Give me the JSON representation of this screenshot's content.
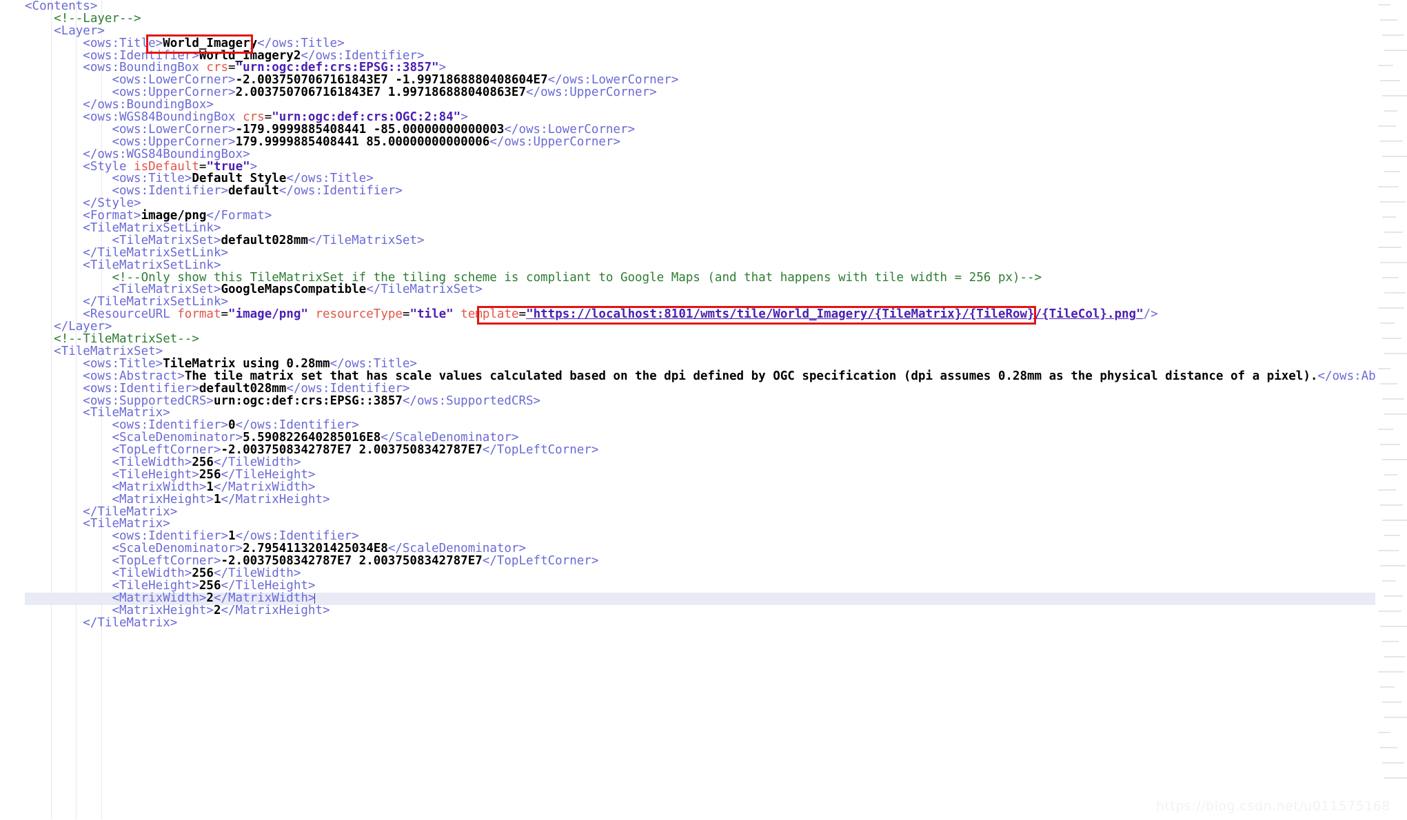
{
  "editor": {
    "language": "xml",
    "watermark": "https://blog.csdn.net/u011575168",
    "caret_line_index": 49,
    "colors": {
      "background": "#ffffff",
      "tag": "#6a6ad6",
      "text": "#000000",
      "attribute_name": "#e0564a",
      "attribute_value": "#4b1fb4",
      "comment": "#2e7d32",
      "annotation_box": "#e41313",
      "current_line_highlight": "#e8eaf6",
      "watermark": "#f2f2f2"
    }
  },
  "annotations": [
    {
      "name": "layer-title-value",
      "label": "World_Imagery"
    },
    {
      "name": "resource-url-template",
      "label": "\"https://localhost:8101/wmts/tile/World_Imagery/{TileMatrix}/{TileRow}/{TileCol}.png\""
    }
  ],
  "code_lines": [
    {
      "indent": 0,
      "tokens": [
        {
          "c": "tag",
          "t": "<Contents>"
        }
      ]
    },
    {
      "indent": 1,
      "tokens": [
        {
          "c": "cmt",
          "t": "<!--Layer-->"
        }
      ]
    },
    {
      "indent": 1,
      "tokens": [
        {
          "c": "tag",
          "t": "<Layer>"
        }
      ]
    },
    {
      "indent": 2,
      "tokens": [
        {
          "c": "tag",
          "t": "<ows:Title>"
        },
        {
          "c": "txt",
          "t": "World_Imagery"
        },
        {
          "c": "tag",
          "t": "</ows:Title>"
        }
      ]
    },
    {
      "indent": 2,
      "tokens": [
        {
          "c": "tag",
          "t": "<ows:Identifier>"
        },
        {
          "c": "txt",
          "t": "World_Imagery2"
        },
        {
          "c": "tag",
          "t": "</ows:Identifier>"
        }
      ]
    },
    {
      "indent": 2,
      "tokens": [
        {
          "c": "tag",
          "t": "<ows:BoundingBox "
        },
        {
          "c": "attr",
          "t": "crs"
        },
        {
          "c": "eq",
          "t": "="
        },
        {
          "c": "val",
          "t": "\"urn:ogc:def:crs:EPSG::3857\""
        },
        {
          "c": "tag",
          "t": ">"
        }
      ]
    },
    {
      "indent": 3,
      "tokens": [
        {
          "c": "tag",
          "t": "<ows:LowerCorner>"
        },
        {
          "c": "txt",
          "t": "-2.0037507067161843E7 -1.9971868880408604E7"
        },
        {
          "c": "tag",
          "t": "</ows:LowerCorner>"
        }
      ]
    },
    {
      "indent": 3,
      "tokens": [
        {
          "c": "tag",
          "t": "<ows:UpperCorner>"
        },
        {
          "c": "txt",
          "t": "2.0037507067161843E7 1.997186888040863E7"
        },
        {
          "c": "tag",
          "t": "</ows:UpperCorner>"
        }
      ]
    },
    {
      "indent": 2,
      "tokens": [
        {
          "c": "tag",
          "t": "</ows:BoundingBox>"
        }
      ]
    },
    {
      "indent": 2,
      "tokens": [
        {
          "c": "tag",
          "t": "<ows:WGS84BoundingBox "
        },
        {
          "c": "attr",
          "t": "crs"
        },
        {
          "c": "eq",
          "t": "="
        },
        {
          "c": "val",
          "t": "\"urn:ogc:def:crs:OGC:2:84\""
        },
        {
          "c": "tag",
          "t": ">"
        }
      ]
    },
    {
      "indent": 3,
      "tokens": [
        {
          "c": "tag",
          "t": "<ows:LowerCorner>"
        },
        {
          "c": "txt",
          "t": "-179.9999885408441 -85.00000000000003"
        },
        {
          "c": "tag",
          "t": "</ows:LowerCorner>"
        }
      ]
    },
    {
      "indent": 3,
      "tokens": [
        {
          "c": "tag",
          "t": "<ows:UpperCorner>"
        },
        {
          "c": "txt",
          "t": "179.9999885408441 85.00000000000006"
        },
        {
          "c": "tag",
          "t": "</ows:UpperCorner>"
        }
      ]
    },
    {
      "indent": 2,
      "tokens": [
        {
          "c": "tag",
          "t": "</ows:WGS84BoundingBox>"
        }
      ]
    },
    {
      "indent": 2,
      "tokens": [
        {
          "c": "tag",
          "t": "<Style "
        },
        {
          "c": "attr",
          "t": "isDefault"
        },
        {
          "c": "eq",
          "t": "="
        },
        {
          "c": "val",
          "t": "\"true\""
        },
        {
          "c": "tag",
          "t": ">"
        }
      ]
    },
    {
      "indent": 3,
      "tokens": [
        {
          "c": "tag",
          "t": "<ows:Title>"
        },
        {
          "c": "txt",
          "t": "Default Style"
        },
        {
          "c": "tag",
          "t": "</ows:Title>"
        }
      ]
    },
    {
      "indent": 3,
      "tokens": [
        {
          "c": "tag",
          "t": "<ows:Identifier>"
        },
        {
          "c": "txt",
          "t": "default"
        },
        {
          "c": "tag",
          "t": "</ows:Identifier>"
        }
      ]
    },
    {
      "indent": 2,
      "tokens": [
        {
          "c": "tag",
          "t": "</Style>"
        }
      ]
    },
    {
      "indent": 2,
      "tokens": [
        {
          "c": "tag",
          "t": "<Format>"
        },
        {
          "c": "txt",
          "t": "image/png"
        },
        {
          "c": "tag",
          "t": "</Format>"
        }
      ]
    },
    {
      "indent": 2,
      "tokens": [
        {
          "c": "tag",
          "t": "<TileMatrixSetLink>"
        }
      ]
    },
    {
      "indent": 3,
      "tokens": [
        {
          "c": "tag",
          "t": "<TileMatrixSet>"
        },
        {
          "c": "txt",
          "t": "default028mm"
        },
        {
          "c": "tag",
          "t": "</TileMatrixSet>"
        }
      ]
    },
    {
      "indent": 2,
      "tokens": [
        {
          "c": "tag",
          "t": "</TileMatrixSetLink>"
        }
      ]
    },
    {
      "indent": 2,
      "tokens": [
        {
          "c": "tag",
          "t": "<TileMatrixSetLink>"
        }
      ]
    },
    {
      "indent": 3,
      "tokens": [
        {
          "c": "cmt",
          "t": "<!--Only show this TileMatrixSet if the tiling scheme is compliant to Google Maps (and that happens with tile width = 256 px)-->"
        }
      ]
    },
    {
      "indent": 3,
      "tokens": [
        {
          "c": "tag",
          "t": "<TileMatrixSet>"
        },
        {
          "c": "txt",
          "t": "GoogleMapsCompatible"
        },
        {
          "c": "tag",
          "t": "</TileMatrixSet>"
        }
      ]
    },
    {
      "indent": 2,
      "tokens": [
        {
          "c": "tag",
          "t": "</TileMatrixSetLink>"
        }
      ]
    },
    {
      "indent": 2,
      "tokens": [
        {
          "c": "tag",
          "t": "<ResourceURL "
        },
        {
          "c": "attr",
          "t": "format"
        },
        {
          "c": "eq",
          "t": "="
        },
        {
          "c": "val",
          "t": "\"image/png\""
        },
        {
          "c": "tag",
          "t": " "
        },
        {
          "c": "attr",
          "t": "resourceType"
        },
        {
          "c": "eq",
          "t": "="
        },
        {
          "c": "val",
          "t": "\"tile\""
        },
        {
          "c": "tag",
          "t": " "
        },
        {
          "c": "attr",
          "t": "template"
        },
        {
          "c": "eq",
          "t": "="
        },
        {
          "c": "link",
          "t": "\"https://localhost:8101/wmts/tile/World_Imagery/{TileMatrix}/{TileRow}/{TileCol}.png\""
        },
        {
          "c": "tag",
          "t": "/>"
        }
      ]
    },
    {
      "indent": 1,
      "tokens": [
        {
          "c": "tag",
          "t": "</Layer>"
        }
      ]
    },
    {
      "indent": 1,
      "tokens": [
        {
          "c": "cmt",
          "t": "<!--TileMatrixSet-->"
        }
      ]
    },
    {
      "indent": 1,
      "tokens": [
        {
          "c": "tag",
          "t": "<TileMatrixSet>"
        }
      ]
    },
    {
      "indent": 2,
      "tokens": [
        {
          "c": "tag",
          "t": "<ows:Title>"
        },
        {
          "c": "txt",
          "t": "TileMatrix using 0.28mm"
        },
        {
          "c": "tag",
          "t": "</ows:Title>"
        }
      ]
    },
    {
      "indent": 2,
      "tokens": [
        {
          "c": "tag",
          "t": "<ows:Abstract>"
        },
        {
          "c": "txt",
          "t": "The tile matrix set that has scale values calculated based on the dpi defined by OGC specification (dpi assumes 0.28mm as the physical distance of a pixel)."
        },
        {
          "c": "tag",
          "t": "</ows:Abstract>"
        }
      ]
    },
    {
      "indent": 2,
      "tokens": [
        {
          "c": "tag",
          "t": "<ows:Identifier>"
        },
        {
          "c": "txt",
          "t": "default028mm"
        },
        {
          "c": "tag",
          "t": "</ows:Identifier>"
        }
      ]
    },
    {
      "indent": 2,
      "tokens": [
        {
          "c": "tag",
          "t": "<ows:SupportedCRS>"
        },
        {
          "c": "txt",
          "t": "urn:ogc:def:crs:EPSG::3857"
        },
        {
          "c": "tag",
          "t": "</ows:SupportedCRS>"
        }
      ]
    },
    {
      "indent": 2,
      "tokens": [
        {
          "c": "tag",
          "t": "<TileMatrix>"
        }
      ]
    },
    {
      "indent": 3,
      "tokens": [
        {
          "c": "tag",
          "t": "<ows:Identifier>"
        },
        {
          "c": "txt",
          "t": "0"
        },
        {
          "c": "tag",
          "t": "</ows:Identifier>"
        }
      ]
    },
    {
      "indent": 3,
      "tokens": [
        {
          "c": "tag",
          "t": "<ScaleDenominator>"
        },
        {
          "c": "txt",
          "t": "5.590822640285016E8"
        },
        {
          "c": "tag",
          "t": "</ScaleDenominator>"
        }
      ]
    },
    {
      "indent": 3,
      "tokens": [
        {
          "c": "tag",
          "t": "<TopLeftCorner>"
        },
        {
          "c": "txt",
          "t": "-2.0037508342787E7 2.0037508342787E7"
        },
        {
          "c": "tag",
          "t": "</TopLeftCorner>"
        }
      ]
    },
    {
      "indent": 3,
      "tokens": [
        {
          "c": "tag",
          "t": "<TileWidth>"
        },
        {
          "c": "txt",
          "t": "256"
        },
        {
          "c": "tag",
          "t": "</TileWidth>"
        }
      ]
    },
    {
      "indent": 3,
      "tokens": [
        {
          "c": "tag",
          "t": "<TileHeight>"
        },
        {
          "c": "txt",
          "t": "256"
        },
        {
          "c": "tag",
          "t": "</TileHeight>"
        }
      ]
    },
    {
      "indent": 3,
      "tokens": [
        {
          "c": "tag",
          "t": "<MatrixWidth>"
        },
        {
          "c": "txt",
          "t": "1"
        },
        {
          "c": "tag",
          "t": "</MatrixWidth>"
        }
      ]
    },
    {
      "indent": 3,
      "tokens": [
        {
          "c": "tag",
          "t": "<MatrixHeight>"
        },
        {
          "c": "txt",
          "t": "1"
        },
        {
          "c": "tag",
          "t": "</MatrixHeight>"
        }
      ]
    },
    {
      "indent": 2,
      "tokens": [
        {
          "c": "tag",
          "t": "</TileMatrix>"
        }
      ]
    },
    {
      "indent": 2,
      "tokens": [
        {
          "c": "tag",
          "t": "<TileMatrix>"
        }
      ]
    },
    {
      "indent": 3,
      "tokens": [
        {
          "c": "tag",
          "t": "<ows:Identifier>"
        },
        {
          "c": "txt",
          "t": "1"
        },
        {
          "c": "tag",
          "t": "</ows:Identifier>"
        }
      ]
    },
    {
      "indent": 3,
      "tokens": [
        {
          "c": "tag",
          "t": "<ScaleDenominator>"
        },
        {
          "c": "txt",
          "t": "2.7954113201425034E8"
        },
        {
          "c": "tag",
          "t": "</ScaleDenominator>"
        }
      ]
    },
    {
      "indent": 3,
      "tokens": [
        {
          "c": "tag",
          "t": "<TopLeftCorner>"
        },
        {
          "c": "txt",
          "t": "-2.0037508342787E7 2.0037508342787E7"
        },
        {
          "c": "tag",
          "t": "</TopLeftCorner>"
        }
      ]
    },
    {
      "indent": 3,
      "tokens": [
        {
          "c": "tag",
          "t": "<TileWidth>"
        },
        {
          "c": "txt",
          "t": "256"
        },
        {
          "c": "tag",
          "t": "</TileWidth>"
        }
      ]
    },
    {
      "indent": 3,
      "tokens": [
        {
          "c": "tag",
          "t": "<TileHeight>"
        },
        {
          "c": "txt",
          "t": "256"
        },
        {
          "c": "tag",
          "t": "</TileHeight>"
        }
      ]
    },
    {
      "indent": 3,
      "tokens": [
        {
          "c": "tag",
          "t": "<MatrixWidth>"
        },
        {
          "c": "txt",
          "t": "2"
        },
        {
          "c": "tag",
          "t": "</MatrixWidth>"
        }
      ],
      "current": true,
      "caret": true
    },
    {
      "indent": 3,
      "tokens": [
        {
          "c": "tag",
          "t": "<MatrixHeight>"
        },
        {
          "c": "txt",
          "t": "2"
        },
        {
          "c": "tag",
          "t": "</MatrixHeight>"
        }
      ]
    },
    {
      "indent": 2,
      "tokens": [
        {
          "c": "tag",
          "t": "</TileMatrix>"
        }
      ]
    }
  ],
  "minimap": {
    "present": true,
    "row_count": 52
  }
}
